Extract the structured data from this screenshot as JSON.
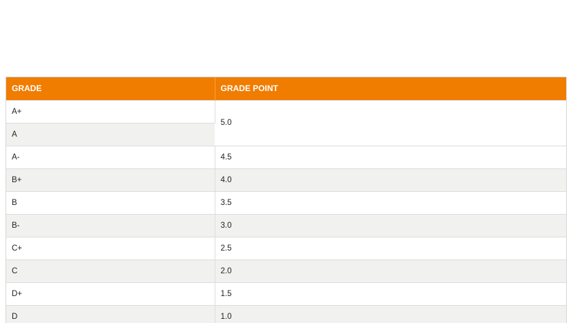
{
  "table": {
    "headers": [
      "GRADE",
      "GRADE POINT"
    ],
    "rows": [
      {
        "grade": "A+",
        "point": "5.0"
      },
      {
        "grade": "A",
        "point": ""
      },
      {
        "grade": "A-",
        "point": "4.5"
      },
      {
        "grade": "B+",
        "point": "4.0"
      },
      {
        "grade": "B",
        "point": "3.5"
      },
      {
        "grade": "B-",
        "point": "3.0"
      },
      {
        "grade": "C+",
        "point": "2.5"
      },
      {
        "grade": "C",
        "point": "2.0"
      },
      {
        "grade": "D+",
        "point": "1.5"
      },
      {
        "grade": "D",
        "point": "1.0"
      }
    ]
  },
  "colors": {
    "header_bg": "#f07c00",
    "header_text": "#ffffff",
    "row_alt_bg": "#f1f1f0"
  }
}
